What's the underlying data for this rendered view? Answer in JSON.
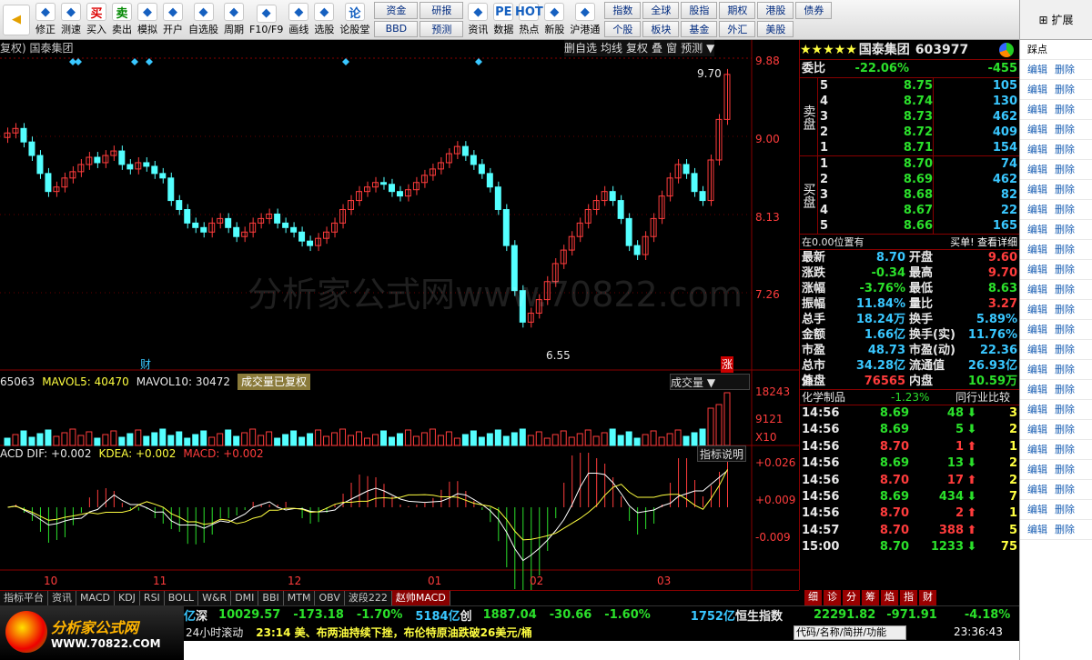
{
  "toolbar": {
    "nav": [
      "资金",
      "研报",
      "BBD",
      "预测"
    ],
    "nav2": [
      "指数",
      "全球",
      "股指",
      "期权",
      "港股",
      "债券",
      "个股",
      "板块",
      "基金",
      "外汇",
      "美股"
    ],
    "buttons": [
      {
        "label": "修正",
        "icon": "arrow-up-icon"
      },
      {
        "label": "测速",
        "icon": "speed-icon"
      },
      {
        "label": "买入",
        "icon": "buy-icon",
        "glyph": "买"
      },
      {
        "label": "卖出",
        "icon": "sell-icon",
        "glyph": "卖"
      },
      {
        "label": "模拟",
        "icon": "hammer-icon"
      },
      {
        "label": "开户",
        "icon": "lock-icon"
      },
      {
        "label": "自选股",
        "icon": "star-icon"
      },
      {
        "label": "周期",
        "icon": "clock-icon"
      },
      {
        "label": "F10/F9",
        "icon": "f10-icon"
      },
      {
        "label": "画线",
        "icon": "pencil-icon"
      },
      {
        "label": "选股",
        "icon": "monitor-icon"
      },
      {
        "label": "论股堂",
        "icon": "talk-icon",
        "glyph": "论"
      },
      {
        "label": "资讯",
        "icon": "newspaper-icon"
      },
      {
        "label": "数据",
        "icon": "pe-icon",
        "glyph": "PE"
      },
      {
        "label": "热点",
        "icon": "hot-icon",
        "glyph": "HOT"
      },
      {
        "label": "新股",
        "icon": "phone-icon"
      },
      {
        "label": "沪港通",
        "icon": "hk-icon"
      }
    ]
  },
  "right_panel": {
    "top_label": "扩展",
    "misc_label": "踩点",
    "edit_label": "编辑",
    "delete_label": "删除"
  },
  "chart": {
    "title": "复权) 国泰集团",
    "toolbar": [
      "删自选",
      "均线",
      "复权",
      "叠",
      "窗",
      "预测"
    ],
    "price_labels": [
      "9.88",
      "9.00",
      "8.13",
      "7.26"
    ],
    "high_label": "9.70",
    "low_label": "6.55",
    "markers": [
      "财",
      "涨"
    ],
    "vol_info": "65063",
    "vol_ma5": "MAVOL5: 40470",
    "vol_ma10": "MAVOL10: 30472",
    "vol_note": "成交量已复权",
    "vol_tab": "成交量",
    "vol_axis": [
      "18243",
      "9121",
      "X10"
    ],
    "macd_info": "ACD DIF: +0.002",
    "macd_kdea": "KDEA: +0.002",
    "macd_macd": "MACD: +0.002",
    "macd_btn": "指标说明",
    "macd_axis": [
      "+0.026",
      "+0.009",
      "-0.009"
    ],
    "months": [
      "10",
      "11",
      "12",
      "01",
      "02",
      "03"
    ],
    "watermark": "分析家公式网www.70822.com"
  },
  "chart_data": {
    "type": "candlestick",
    "series": [
      {
        "name": "price",
        "values": [
          9.05,
          9.1,
          8.95,
          8.8,
          8.6,
          8.4,
          8.45,
          8.55,
          8.62,
          8.7,
          8.78,
          8.72,
          8.8,
          8.85,
          8.7,
          8.65,
          8.72,
          8.68,
          8.6,
          8.55,
          8.3,
          8.2,
          8.05,
          8.0,
          7.95,
          8.05,
          8.1,
          8.0,
          7.9,
          7.95,
          8.05,
          8.1,
          8.15,
          8.05,
          8.0,
          7.95,
          7.85,
          7.8,
          7.88,
          7.95,
          8.05,
          8.2,
          8.3,
          8.4,
          8.45,
          8.5,
          8.48,
          8.4,
          8.35,
          8.42,
          8.5,
          8.58,
          8.65,
          8.72,
          8.82,
          8.9,
          8.8,
          8.7,
          8.6,
          8.45,
          8.2,
          7.8,
          7.3,
          6.95,
          7.05,
          7.2,
          7.4,
          7.6,
          7.75,
          7.9,
          8.05,
          8.2,
          8.3,
          8.4,
          8.3,
          8.1,
          7.8,
          7.7,
          7.9,
          8.1,
          8.35,
          8.55,
          8.7,
          8.6,
          8.4,
          8.3,
          8.75,
          9.2,
          9.7
        ]
      }
    ],
    "price_range": [
      6.55,
      9.88
    ]
  },
  "quote": {
    "stars": "★★★★★",
    "name": "国泰集团",
    "code": "603977",
    "wb_label": "委比",
    "wb_val": "-22.06%",
    "wb_diff": "-455",
    "sell_label": "卖盘",
    "buy_label": "买盘",
    "sells": [
      {
        "lvl": "5",
        "price": "8.75",
        "vol": "105"
      },
      {
        "lvl": "4",
        "price": "8.74",
        "vol": "130"
      },
      {
        "lvl": "3",
        "price": "8.73",
        "vol": "462"
      },
      {
        "lvl": "2",
        "price": "8.72",
        "vol": "409"
      },
      {
        "lvl": "1",
        "price": "8.71",
        "vol": "154"
      }
    ],
    "buys": [
      {
        "lvl": "1",
        "price": "8.70",
        "vol": "74"
      },
      {
        "lvl": "2",
        "price": "8.69",
        "vol": "462"
      },
      {
        "lvl": "3",
        "price": "8.68",
        "vol": "82"
      },
      {
        "lvl": "4",
        "price": "8.67",
        "vol": "22"
      },
      {
        "lvl": "5",
        "price": "8.66",
        "vol": "165"
      }
    ],
    "pos_note": "在0.00位置有",
    "buy_note": "买单! 查看详细",
    "stats": [
      {
        "l": "最新",
        "v": "8.70",
        "l2": "开盘",
        "v2": "9.60"
      },
      {
        "l": "涨跌",
        "v": "-0.34",
        "l2": "最高",
        "v2": "9.70"
      },
      {
        "l": "涨幅",
        "v": "-3.76%",
        "l2": "最低",
        "v2": "8.63"
      },
      {
        "l": "振幅",
        "v": "11.84%",
        "l2": "量比",
        "v2": "3.27"
      },
      {
        "l": "总手",
        "v": "18.24万",
        "l2": "换手",
        "v2": "5.89%"
      },
      {
        "l": "金额",
        "v": "1.66亿",
        "l2": "换手(实)",
        "v2": "11.76%"
      },
      {
        "l": "市盈",
        "v": "48.73",
        "l2": "市盈(动)",
        "v2": "22.36"
      },
      {
        "l": "总市值",
        "v": "34.28亿",
        "l2": "流通值",
        "v2": "26.93亿"
      },
      {
        "l": "外盘",
        "v": "76565",
        "l2": "内盘",
        "v2": "10.59万"
      }
    ],
    "industry": "化学制品",
    "industry_pct": "-1.23%",
    "industry_btn": "同行业比较",
    "ticks": [
      {
        "t": "14:56",
        "p": "8.69",
        "v": "48",
        "d": "down",
        "n": "3"
      },
      {
        "t": "14:56",
        "p": "8.69",
        "v": "5",
        "d": "down",
        "n": "2"
      },
      {
        "t": "14:56",
        "p": "8.70",
        "v": "1",
        "d": "up",
        "n": "1"
      },
      {
        "t": "14:56",
        "p": "8.69",
        "v": "13",
        "d": "down",
        "n": "2"
      },
      {
        "t": "14:56",
        "p": "8.70",
        "v": "17",
        "d": "up",
        "n": "2"
      },
      {
        "t": "14:56",
        "p": "8.69",
        "v": "434",
        "d": "down",
        "n": "7"
      },
      {
        "t": "14:56",
        "p": "8.70",
        "v": "2",
        "d": "up",
        "n": "1"
      },
      {
        "t": "14:57",
        "p": "8.70",
        "v": "388",
        "d": "up",
        "n": "5"
      },
      {
        "t": "15:00",
        "p": "8.70",
        "v": "1233",
        "d": "down",
        "n": "75"
      }
    ]
  },
  "tabs": [
    "指标平台",
    "资讯",
    "MACD",
    "KDJ",
    "RSI",
    "BOLL",
    "W&R",
    "DMI",
    "BBI",
    "MTM",
    "OBV",
    "波段222",
    "赵帅MACD"
  ],
  "rtabs": [
    "细",
    "诊",
    "分",
    "筹",
    "焰",
    "指",
    "财"
  ],
  "index_bar": {
    "a": "亿",
    "sz_label": "深",
    "sz_val": "10029.57",
    "sz_chg": "-173.18",
    "sz_pct": "-1.70%",
    "cy_vol": "5184亿",
    "cy_label": "创",
    "cy_val": "1887.04",
    "cy_chg": "-30.66",
    "cy_pct": "-1.60%",
    "hs_vol": "1752亿",
    "hs_label": "恒生指数",
    "hs_val": "22291.82",
    "hs_chg": "-971.91",
    "hs_pct": "-4.18%"
  },
  "news": {
    "label": "24小时滚动",
    "text": "23:14 美、布两油持续下挫，布伦特原油跌破26美元/桶"
  },
  "logo": {
    "line1": "分析家公式网",
    "line2": "WWW.70822.COM"
  },
  "search_placeholder": "代码/名称/简拼/功能",
  "clock": "23:36:43"
}
